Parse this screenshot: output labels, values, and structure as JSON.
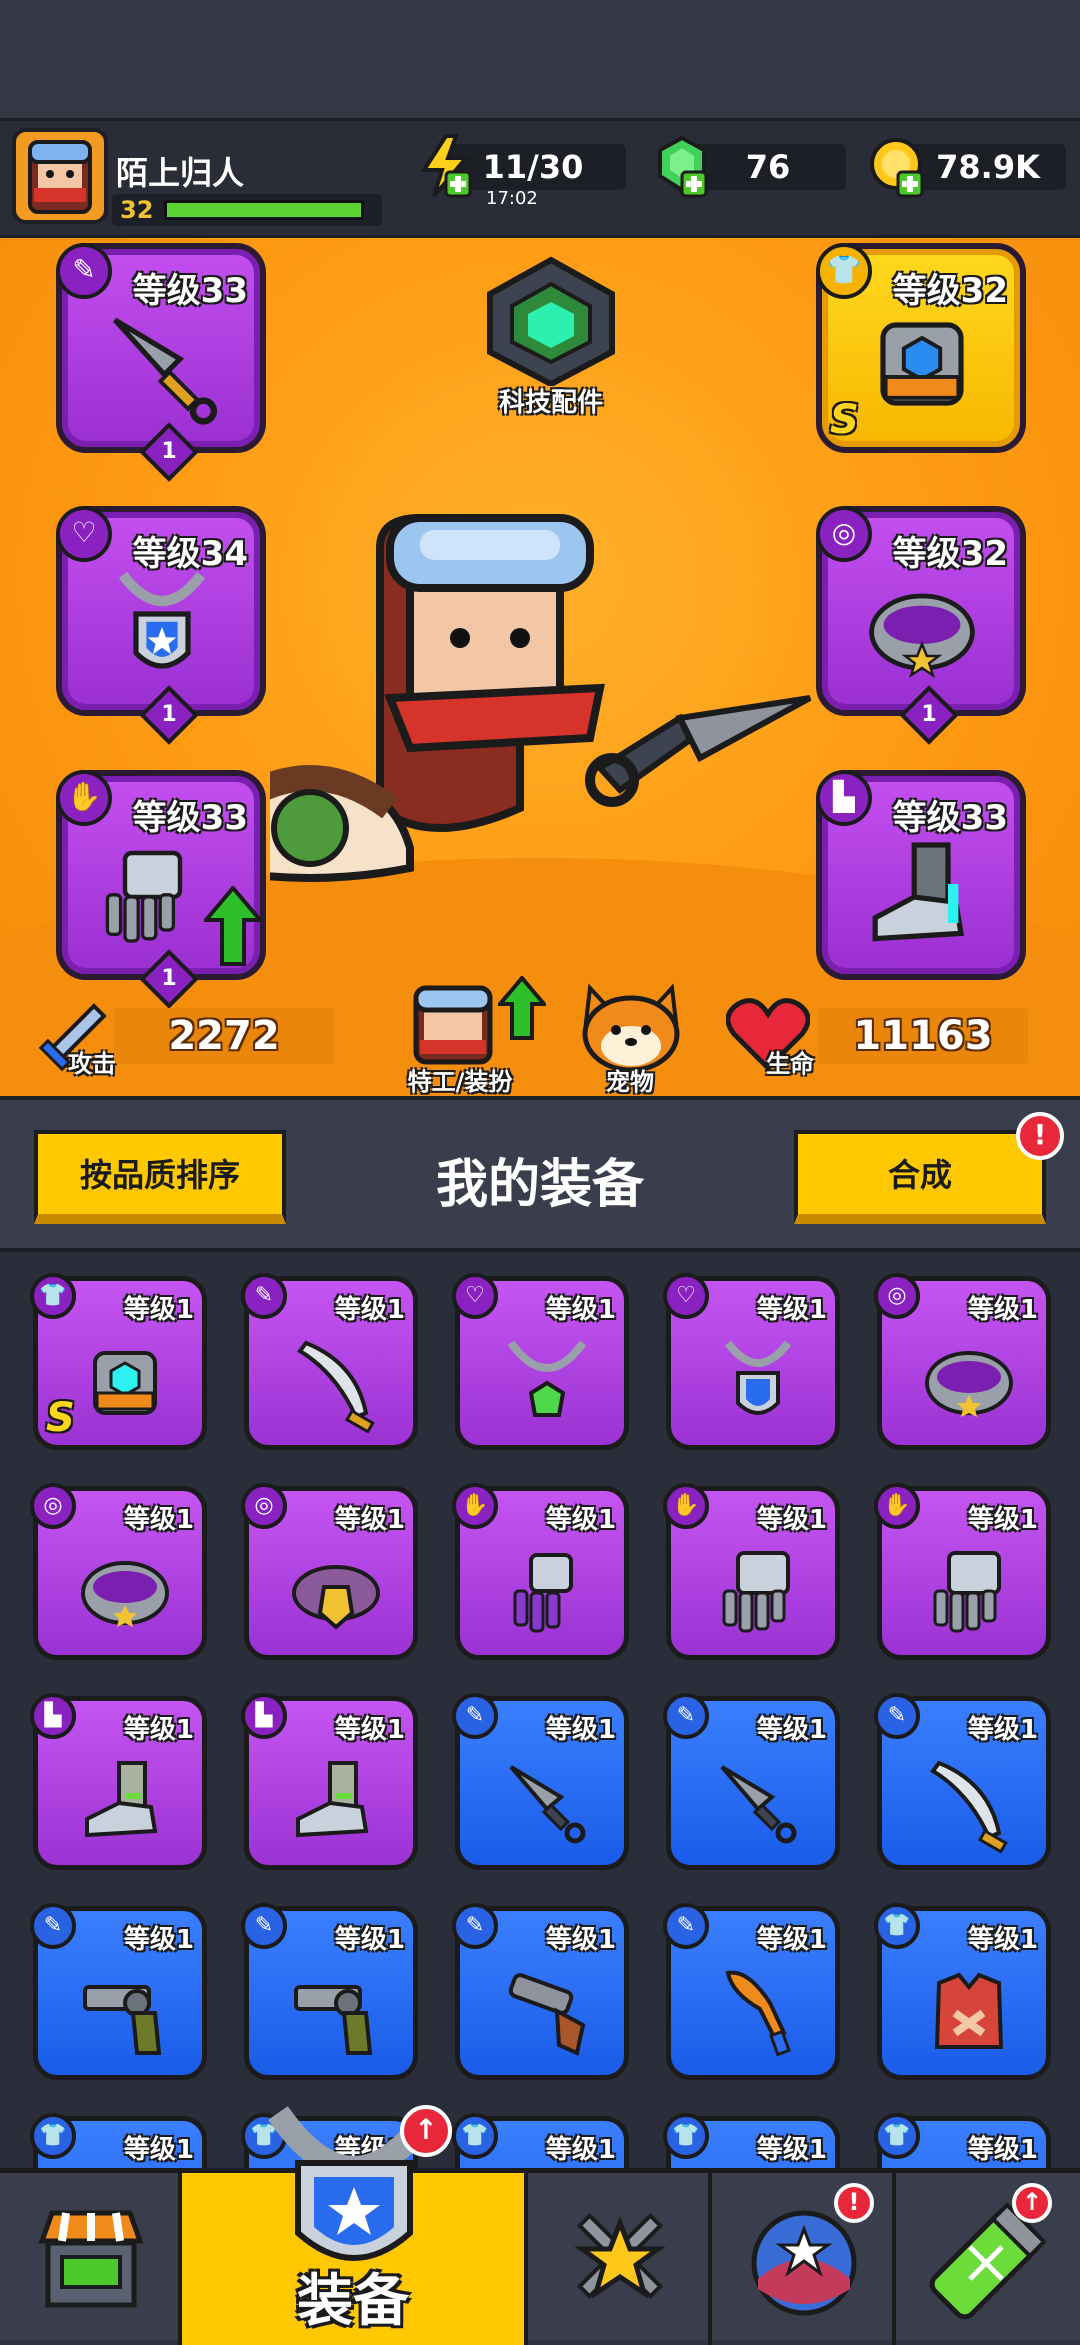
{
  "player": {
    "name": "陌上归人",
    "level": "32",
    "xp_fraction": 0.95
  },
  "resources": {
    "energy": {
      "icon": "lightning-icon",
      "value": "11/30",
      "timer": "17:02"
    },
    "gems": {
      "icon": "green-gem-icon",
      "value": "76"
    },
    "coins": {
      "icon": "gold-coin-icon",
      "value": "78.9K"
    }
  },
  "hero": {
    "tech_parts_label": "科技配件",
    "slots": [
      {
        "slot": "weapon",
        "icon": "kunai-icon",
        "level": "等级33",
        "count": "1",
        "rarity": "purple"
      },
      {
        "slot": "armor",
        "icon": "mech-armor-icon",
        "level": "等级32",
        "rarity": "gold",
        "grade": "S"
      },
      {
        "slot": "necklace",
        "icon": "shield-necklace-icon",
        "level": "等级34",
        "count": "1",
        "rarity": "purple"
      },
      {
        "slot": "belt",
        "icon": "belt-icon",
        "level": "等级32",
        "count": "1",
        "rarity": "purple"
      },
      {
        "slot": "gloves",
        "icon": "gauntlet-icon",
        "level": "等级33",
        "count": "1",
        "rarity": "purple"
      },
      {
        "slot": "boots",
        "icon": "boot-icon",
        "level": "等级33",
        "rarity": "purple"
      }
    ],
    "attack_label": "攻击",
    "attack_value": "2272",
    "hp_label": "生命",
    "hp_value": "11163",
    "agent_label": "特工/装扮",
    "pet_label": "宠物"
  },
  "equipment": {
    "sort_button": "按品质排序",
    "title": "我的装备",
    "merge_button": "合成",
    "merge_alert": "!",
    "items": [
      {
        "icon": "mech-armor-icon",
        "level": "等级1",
        "rarity": "purple",
        "grade": "S"
      },
      {
        "icon": "machete-icon",
        "level": "等级1",
        "rarity": "purple"
      },
      {
        "icon": "emerald-necklace-icon",
        "level": "等级1",
        "rarity": "purple"
      },
      {
        "icon": "shield-necklace-icon",
        "level": "等级1",
        "rarity": "purple"
      },
      {
        "icon": "belt-icon",
        "level": "等级1",
        "rarity": "purple"
      },
      {
        "icon": "belt-icon",
        "level": "等级1",
        "rarity": "purple"
      },
      {
        "icon": "armored-belt-icon",
        "level": "等级1",
        "rarity": "purple"
      },
      {
        "icon": "purple-gauntlet-icon",
        "level": "等级1",
        "rarity": "purple"
      },
      {
        "icon": "gauntlet-icon",
        "level": "等级1",
        "rarity": "purple"
      },
      {
        "icon": "gauntlet-icon",
        "level": "等级1",
        "rarity": "purple"
      },
      {
        "icon": "boot-icon",
        "level": "等级1",
        "rarity": "purple"
      },
      {
        "icon": "boot-icon",
        "level": "等级1",
        "rarity": "purple"
      },
      {
        "icon": "kunai-icon",
        "level": "等级1",
        "rarity": "blue"
      },
      {
        "icon": "kunai-icon",
        "level": "等级1",
        "rarity": "blue"
      },
      {
        "icon": "machete-icon",
        "level": "等级1",
        "rarity": "blue"
      },
      {
        "icon": "revolver-icon",
        "level": "等级1",
        "rarity": "blue"
      },
      {
        "icon": "revolver-icon",
        "level": "等级1",
        "rarity": "blue"
      },
      {
        "icon": "shotgun-icon",
        "level": "等级1",
        "rarity": "blue"
      },
      {
        "icon": "baseball-bat-icon",
        "level": "等级1",
        "rarity": "blue"
      },
      {
        "icon": "vest-icon",
        "level": "等级1",
        "rarity": "blue"
      },
      {
        "icon": "armor-icon",
        "level": "等级1",
        "rarity": "blue"
      },
      {
        "icon": "armor-icon",
        "level": "等级1",
        "rarity": "blue"
      },
      {
        "icon": "armor-icon",
        "level": "等级1",
        "rarity": "blue"
      },
      {
        "icon": "armor-icon",
        "level": "等级1",
        "rarity": "blue"
      },
      {
        "icon": "armor-icon",
        "level": "等级1",
        "rarity": "blue"
      }
    ]
  },
  "nav": {
    "tabs": [
      {
        "name": "shop",
        "icon": "shop-icon",
        "label": ""
      },
      {
        "name": "equipment",
        "icon": "shield-necklace-icon",
        "label": "装备",
        "active": true,
        "alert": "↑"
      },
      {
        "name": "battle",
        "icon": "crossed-swords-star-icon",
        "label": ""
      },
      {
        "name": "stars",
        "icon": "star-orb-icon",
        "label": "",
        "alert": "!"
      },
      {
        "name": "dna",
        "icon": "dna-capsule-icon",
        "label": "",
        "alert": "↑"
      }
    ]
  },
  "colors": {
    "purple": "#a83ce0",
    "gold": "#ffc800",
    "blue": "#2a6cf0",
    "orange": "#ff9a12",
    "health_red": "#e8283a"
  }
}
